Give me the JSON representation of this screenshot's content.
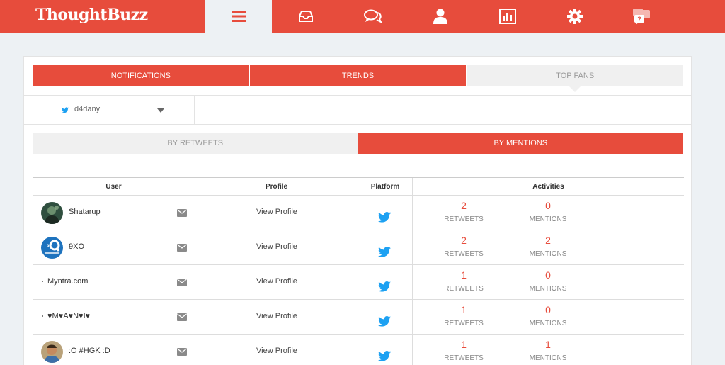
{
  "app": {
    "logo": "ThoughtBuzz"
  },
  "nav": {
    "items": [
      {
        "icon": "menu-icon",
        "active": true
      },
      {
        "icon": "inbox-icon",
        "active": false
      },
      {
        "icon": "chat-icon",
        "active": false
      },
      {
        "icon": "user-icon",
        "active": false
      },
      {
        "icon": "bar-chart-icon",
        "active": false
      },
      {
        "icon": "gear-icon",
        "active": false
      },
      {
        "icon": "help-chat-icon",
        "active": false
      }
    ]
  },
  "main_tabs": [
    {
      "label": "NOTIFICATIONS",
      "active": false
    },
    {
      "label": "TRENDS",
      "active": false
    },
    {
      "label": "TOP FANS",
      "active": true
    }
  ],
  "account_selector": {
    "platform_icon": "twitter-icon",
    "value": "d4dany"
  },
  "sub_tabs": [
    {
      "label": "BY RETWEETS",
      "active": false
    },
    {
      "label": "BY MENTIONS",
      "active": true
    }
  ],
  "table": {
    "headers": {
      "user": "User",
      "profile": "Profile",
      "platform": "Platform",
      "activities": "Activities"
    },
    "rows": [
      {
        "user": "Shatarup",
        "profile": "View Profile",
        "platform": "twitter-icon",
        "retweets": "2",
        "retweets_label": "RETWEETS",
        "mentions": "0",
        "mentions_label": "MENTIONS"
      },
      {
        "user": "9XO",
        "profile": "View Profile",
        "platform": "twitter-icon",
        "retweets": "2",
        "retweets_label": "RETWEETS",
        "mentions": "2",
        "mentions_label": "MENTIONS"
      },
      {
        "user": "Myntra.com",
        "profile": "View Profile",
        "platform": "twitter-icon",
        "retweets": "1",
        "retweets_label": "RETWEETS",
        "mentions": "0",
        "mentions_label": "MENTIONS"
      },
      {
        "user": "♥M♥A♥N♥I♥",
        "profile": "View Profile",
        "platform": "twitter-icon",
        "retweets": "1",
        "retweets_label": "RETWEETS",
        "mentions": "0",
        "mentions_label": "MENTIONS"
      },
      {
        "user": ":O #HGK :D",
        "profile": "View Profile",
        "platform": "twitter-icon",
        "retweets": "1",
        "retweets_label": "RETWEETS",
        "mentions": "1",
        "mentions_label": "MENTIONS"
      }
    ]
  },
  "colors": {
    "accent": "#e74c3c",
    "twitter": "#1da1f2",
    "background": "#edf1f4"
  }
}
